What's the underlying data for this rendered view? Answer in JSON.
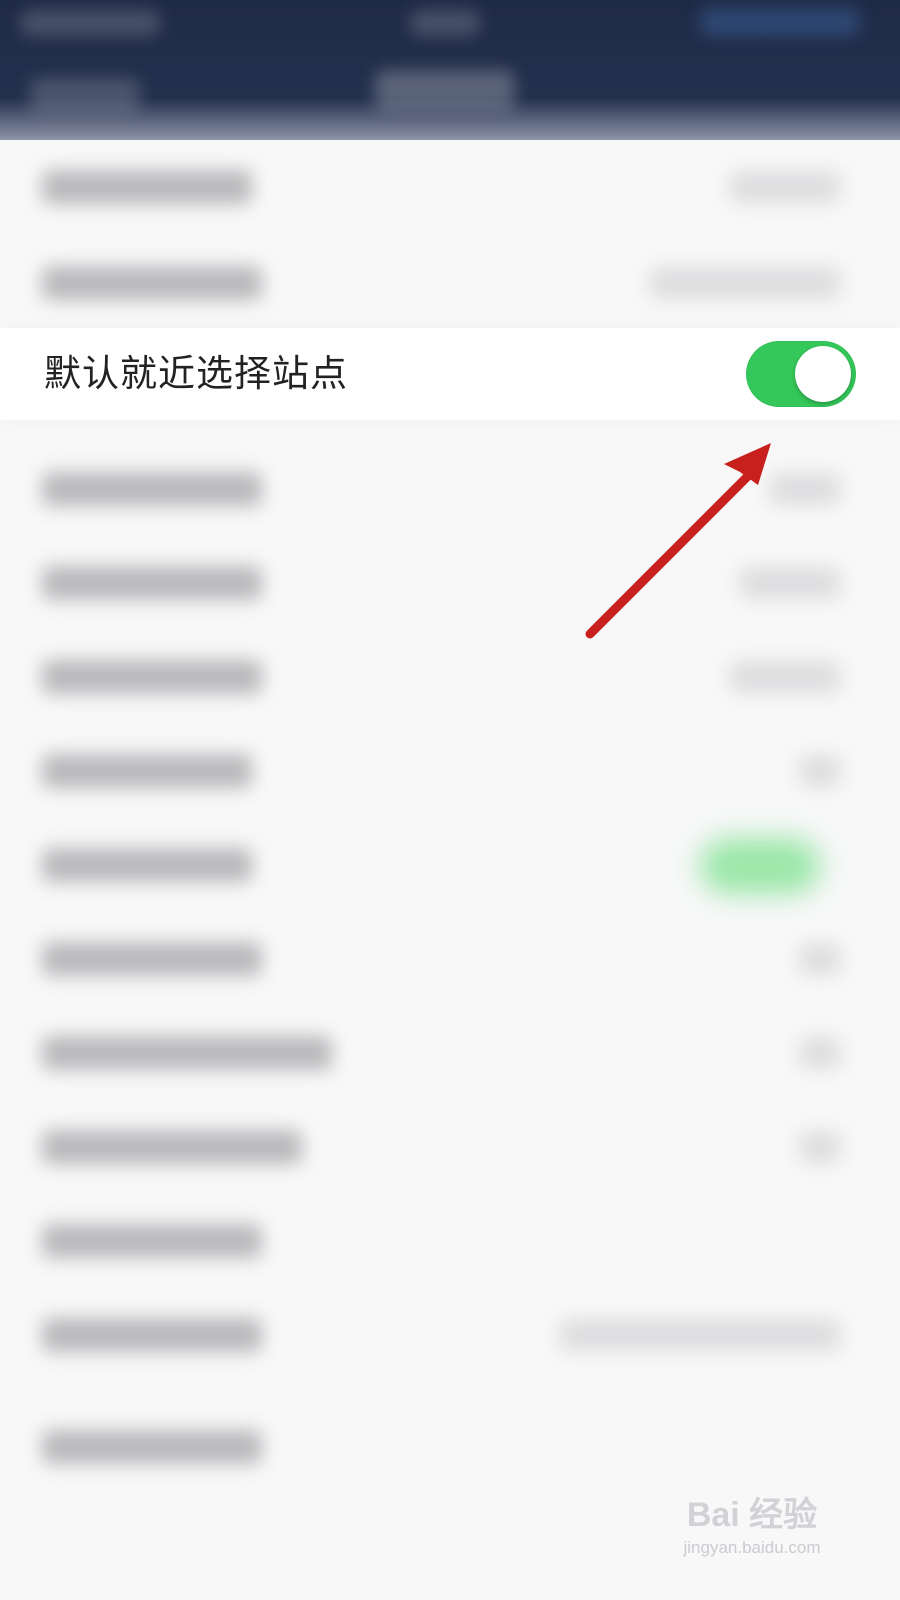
{
  "setting": {
    "label": "默认就近选择站点",
    "enabled": true,
    "switch_color": "#34c759"
  },
  "annotation": {
    "arrow_color": "#c8201c"
  },
  "watermark": {
    "logo": "Bai 经验",
    "url": "jingyan.baidu.com"
  }
}
